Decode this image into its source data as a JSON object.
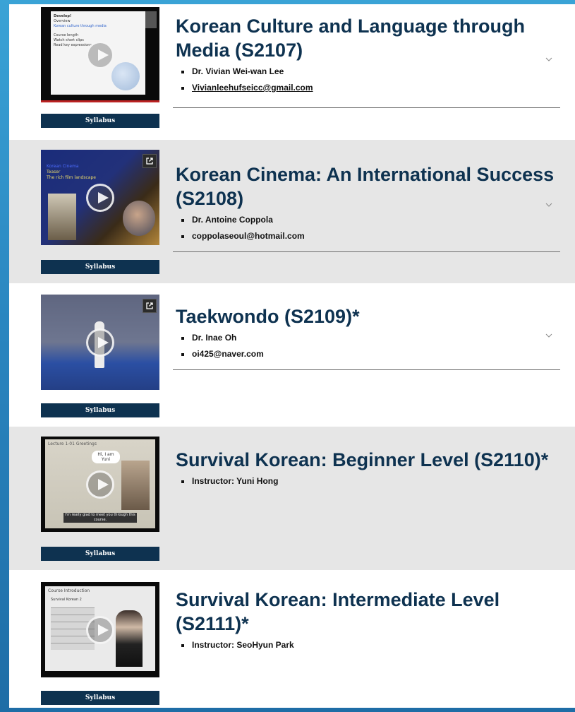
{
  "courses": [
    {
      "title": "Korean Culture and Language through Media (S2107)",
      "lines": [
        "Dr. Vivian Wei-wan Lee",
        "Vivianleehufseicc@gmail.com"
      ],
      "email_link": true,
      "syllabus_label": "Syllabus",
      "has_external_icon": false,
      "thumb_text": [
        "Develop!",
        "Overview",
        "Korean culture through media",
        "Course length",
        "Watch short clips",
        "Read key expressions"
      ]
    },
    {
      "title": "Korean Cinema: An International Success (S2108)",
      "lines": [
        "Dr. Antoine Coppola",
        "coppolaseoul@hotmail.com"
      ],
      "email_link": false,
      "syllabus_label": "Syllabus",
      "has_external_icon": true,
      "thumb_text": [
        "Korean Cinema",
        "Teaser",
        "The rich film landscape"
      ]
    },
    {
      "title": "Taekwondo (S2109)*",
      "lines": [
        "Dr. Inae Oh",
        "oi425@naver.com"
      ],
      "email_link": false,
      "syllabus_label": "Syllabus",
      "has_external_icon": true,
      "thumb_text": []
    },
    {
      "title": "Survival Korean: Beginner Level (S2110)*",
      "lines": [
        "Instructor: Yuni Hong"
      ],
      "email_link": false,
      "syllabus_label": "Syllabus",
      "has_external_icon": false,
      "thumb_text": [
        "Lecture 1-01 Greetings",
        "Hi, I am Yuni",
        "I'm really glad to meet you through this course."
      ]
    },
    {
      "title": "Survival Korean: Intermediate Level (S2111)*",
      "lines": [
        "Instructor: SeoHyun Park"
      ],
      "email_link": false,
      "syllabus_label": "Syllabus",
      "has_external_icon": false,
      "thumb_text": [
        "Course Introduction",
        "Survival Korean 2"
      ]
    }
  ],
  "colors": {
    "title": "#0e3250",
    "syllabus_bg": "#0e3250",
    "alt_row_bg": "#e6e6e6",
    "page_bg": "#2a86c0"
  },
  "icons": [
    "play-icon",
    "external-link-icon",
    "chevron-down-icon",
    "bullet-icon"
  ]
}
